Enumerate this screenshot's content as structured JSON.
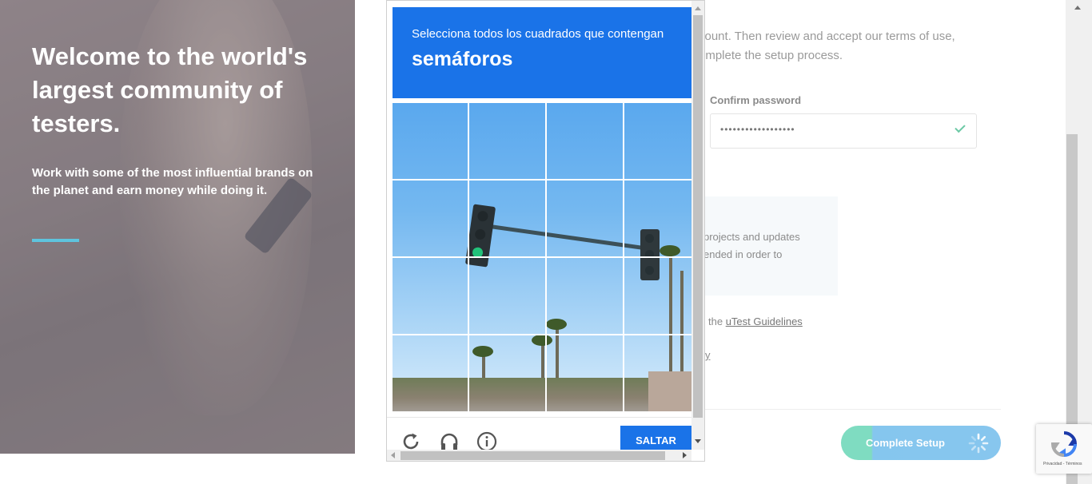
{
  "hero": {
    "title": "Welcome to the world's largest community of testers.",
    "subtitle": "Work with some of the most influential brands on the planet and earn money while doing it."
  },
  "form": {
    "intro_line1": "count. Then review and accept our terms of use,",
    "intro_line2": "omplete the setup process.",
    "confirm_password_label": "Confirm password",
    "confirm_password_value": "••••••••••••••••••",
    "info_line1": "projects and updates",
    "info_line2": "ended in order to",
    "guidelines_prefix": "the ",
    "guidelines_link": "uTest Guidelines",
    "fragment_y": "y",
    "complete_button": "Complete Setup"
  },
  "captcha": {
    "instruction": "Selecciona todos los cuadrados que contengan",
    "target": "semáforos",
    "skip_button": "SALTAR",
    "icons": [
      "reload-icon",
      "audio-headphones-icon",
      "info-icon"
    ],
    "grid": {
      "rows": 4,
      "cols": 4
    }
  },
  "recaptcha_badge": {
    "text": "Privacidad - Términos"
  },
  "colors": {
    "captcha_blue": "#1a73e8",
    "accent_cyan": "#5ec4de",
    "button_green": "#7fdcc1",
    "button_blue": "#87c6ee"
  }
}
